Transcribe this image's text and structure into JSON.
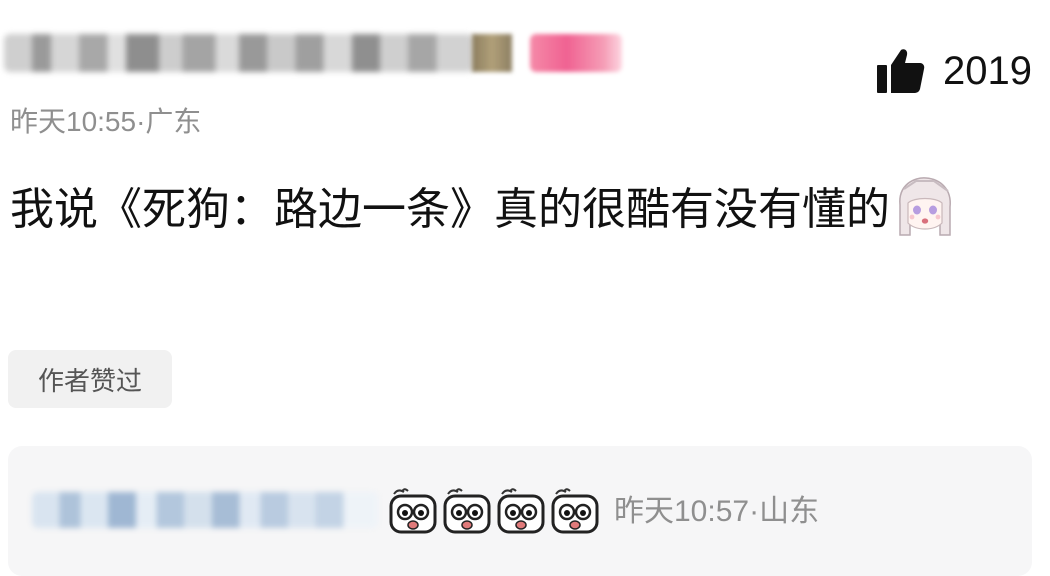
{
  "comment": {
    "time_location": "昨天10:55·广东",
    "like_count": "2019",
    "text": "我说《死狗：路边一条》真的很酷有没有懂的",
    "author_liked_tag": "作者赞过",
    "sticker": "anime-girl-sticker"
  },
  "reply": {
    "time_location": "昨天10:57·山东",
    "emojis": [
      "staring-face-icon",
      "staring-face-icon",
      "staring-face-icon",
      "staring-face-icon"
    ]
  },
  "icons": {
    "like": "thumbs-up-icon"
  },
  "colors": {
    "meta_text": "#8f8f8f",
    "tag_bg": "#f1f1f1",
    "reply_bg": "#f6f6f7"
  }
}
